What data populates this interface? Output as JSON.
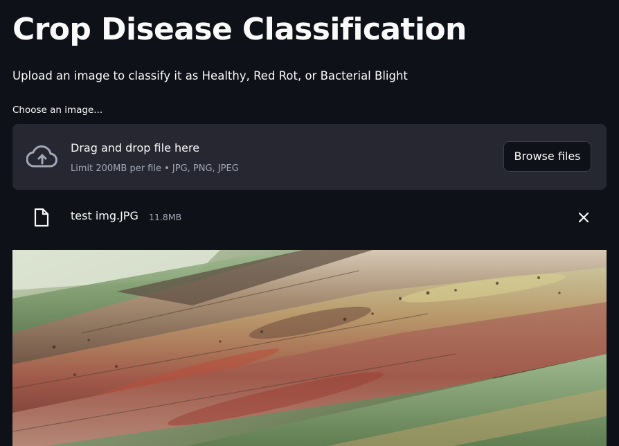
{
  "app": {
    "title": "Crop Disease Classification",
    "subtitle": "Upload an image to classify it as Healthy, Red Rot, or Bacterial Blight"
  },
  "uploader": {
    "label": "Choose an image...",
    "drop_text": "Drag and drop file here",
    "limit_text": "Limit 200MB per file • JPG, PNG, JPEG",
    "browse_label": "Browse files",
    "upload_icon": "cloud-upload-icon"
  },
  "file": {
    "name": "test img.JPG",
    "size": "11.8MB",
    "file_icon": "file-icon",
    "remove_icon": "close-icon"
  },
  "colors": {
    "background": "#0e1117",
    "dropzone": "#262730",
    "text": "#fafafa",
    "muted_text": "#a3a8b8"
  }
}
